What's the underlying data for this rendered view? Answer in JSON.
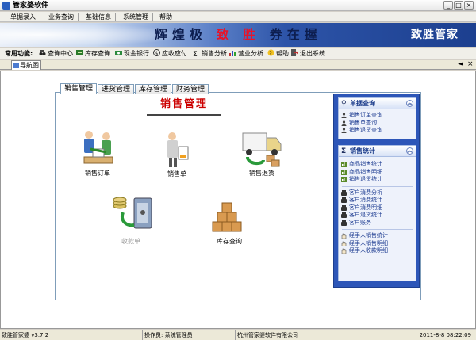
{
  "window": {
    "title": "管家婆软件",
    "buttons": [
      "_",
      "□",
      "×"
    ]
  },
  "menubar": {
    "items": [
      {
        "label": "单据录入"
      },
      {
        "label": "业务查询"
      },
      {
        "label": "基础信息"
      },
      {
        "label": "系统管理"
      },
      {
        "label": "帮助"
      }
    ]
  },
  "banner": {
    "slogan_part1": "辉煌极",
    "slogan_part2": "致 胜",
    "slogan_part3": "券在握",
    "brand": "致胜管家"
  },
  "toolbar": {
    "label": "常用功能:",
    "buttons": [
      {
        "label": "查询中心",
        "icon": "binoculars-icon"
      },
      {
        "label": "库存查询",
        "icon": "inventory-icon"
      },
      {
        "label": "现金银行",
        "icon": "cash-icon"
      },
      {
        "label": "应收应付",
        "icon": "receivable-icon"
      },
      {
        "label": "销售分析",
        "icon": "sigma-icon"
      },
      {
        "label": "营业分析",
        "icon": "chart-icon"
      },
      {
        "label": "帮助",
        "icon": "help-icon"
      },
      {
        "label": "退出系统",
        "icon": "exit-icon"
      }
    ]
  },
  "doc_tab": {
    "label": "导航图",
    "close": "×",
    "back": "◄"
  },
  "section_tabs": [
    {
      "label": "销售管理",
      "active": true
    },
    {
      "label": "进货管理",
      "active": false
    },
    {
      "label": "库存管理",
      "active": false
    },
    {
      "label": "财务管理",
      "active": false
    }
  ],
  "panel": {
    "title": "销售管理",
    "functions": {
      "sales_order": "销售订单",
      "sales_slip": "销售单",
      "sales_return": "销售退货",
      "receipt": "收款单",
      "stock_query": "库存查询"
    }
  },
  "side_panel": {
    "group1": {
      "title": "单据查询",
      "items": [
        "销售订单查询",
        "销售单查询",
        "销售退货查询"
      ]
    },
    "group2": {
      "title": "销售统计",
      "items_a": [
        "商品销售统计",
        "商品销售明细",
        "销售退货统计"
      ],
      "items_b": [
        "客户消费分析",
        "客户消费统计",
        "客户消费明细",
        "客户退货统计",
        "客户账务"
      ],
      "items_c": [
        "经手人销售统计",
        "经手人销售明细",
        "经手人收款明细"
      ]
    }
  },
  "statusbar": {
    "version": "致胜管家婆 v3.7.2",
    "operator": "操作员: 系统管理员",
    "company": "杭州管家婆软件有限公司",
    "datetime": "2011-8-8 08:22:09"
  },
  "colors": {
    "title_red": "#cc0000",
    "side_bg": "#2d56b8",
    "banner_dark": "#1c3f8f"
  }
}
